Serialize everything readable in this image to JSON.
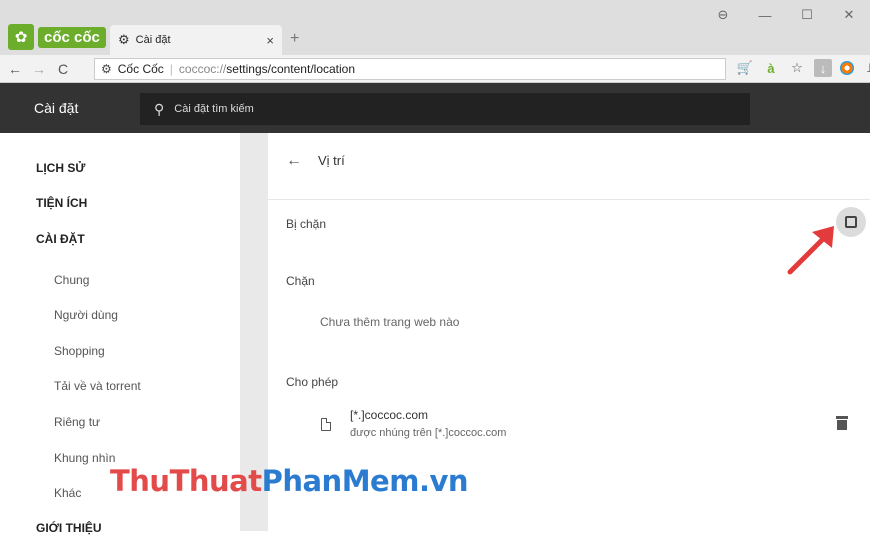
{
  "browser": {
    "brand": "cốc cốc",
    "tab": {
      "title": "Cài đặt",
      "close": "×"
    },
    "new_tab": "+",
    "window_controls": [
      "⊖",
      "—",
      "☐",
      "✕"
    ],
    "toolbar": {
      "back": "←",
      "forward": "→",
      "reload": "C",
      "site_name": "Cốc Cốc",
      "url_scheme": "coccoc://",
      "url_rest": "settings/content/location"
    },
    "toolbar_icons": {
      "cart": "🛒",
      "accent": "à",
      "star": "☆",
      "download": "↓",
      "menu": "⫫"
    }
  },
  "settings": {
    "header_title": "Cài đặt",
    "search_placeholder": "Cài đặt tìm kiếm"
  },
  "sidebar": {
    "sections": [
      "LỊCH SỬ",
      "TIỆN ÍCH",
      "CÀI ĐẶT"
    ],
    "sub_items": [
      "Chung",
      "Người dùng",
      "Shopping",
      "Tải về và torrent",
      "Riêng tư",
      "Khung nhìn",
      "Khác"
    ],
    "footer_section": "GIỚI THIỆU"
  },
  "content": {
    "back": "←",
    "title": "Vị trí",
    "blocked_toggle_label": "Bị chặn",
    "block_heading": "Chặn",
    "block_empty": "Chưa thêm trang web nào",
    "allow_heading": "Cho phép",
    "allow_entry": {
      "site": "[*.]coccoc.com",
      "detail": "được nhúng trên [*.]coccoc.com"
    }
  },
  "watermark": {
    "part1": "ThuThuat",
    "part2": "PhanMem.vn"
  },
  "colors": {
    "brand_green": "#6cae2c",
    "header_dark": "#333333",
    "arrow_red": "#e33b3b"
  }
}
